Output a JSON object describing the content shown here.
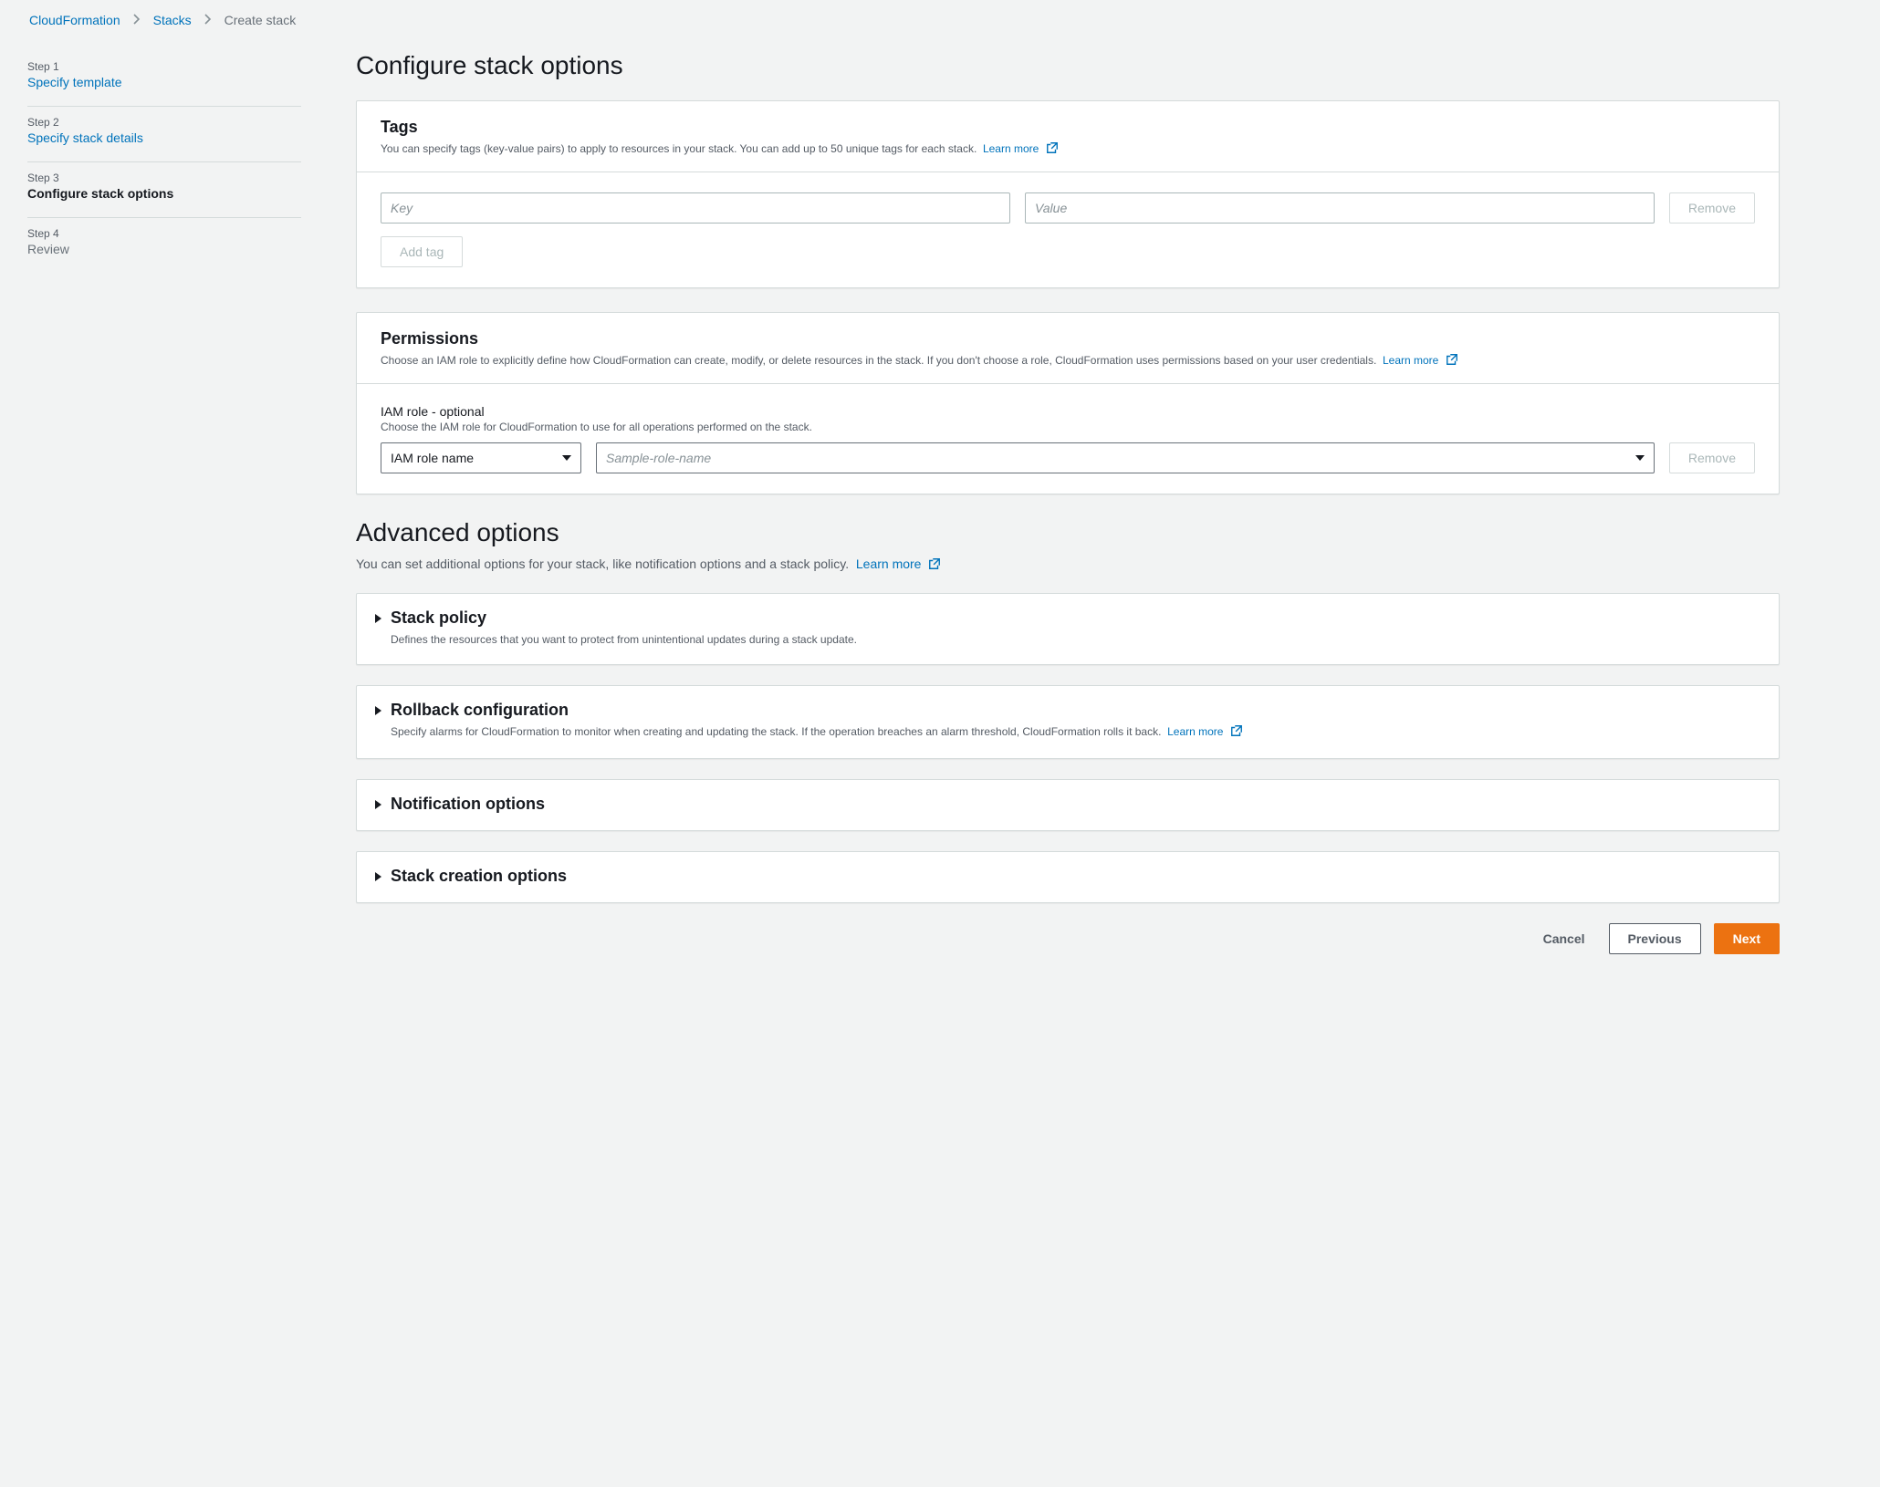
{
  "breadcrumb": {
    "items": [
      {
        "label": "CloudFormation",
        "link": true
      },
      {
        "label": "Stacks",
        "link": true
      },
      {
        "label": "Create stack",
        "link": false
      }
    ]
  },
  "steps": [
    {
      "num": "Step 1",
      "title": "Specify template",
      "state": "link"
    },
    {
      "num": "Step 2",
      "title": "Specify stack details",
      "state": "link"
    },
    {
      "num": "Step 3",
      "title": "Configure stack options",
      "state": "current"
    },
    {
      "num": "Step 4",
      "title": "Review",
      "state": "muted"
    }
  ],
  "page_title": "Configure stack options",
  "tags_panel": {
    "heading": "Tags",
    "description": "You can specify tags (key-value pairs) to apply to resources in your stack. You can add up to 50 unique tags for each stack.",
    "learn_more": "Learn more",
    "key_placeholder": "Key",
    "value_placeholder": "Value",
    "remove_label": "Remove",
    "add_tag_label": "Add tag"
  },
  "permissions_panel": {
    "heading": "Permissions",
    "description": "Choose an IAM role to explicitly define how CloudFormation can create, modify, or delete resources in the stack. If you don't choose a role, CloudFormation uses permissions based on your user credentials.",
    "learn_more": "Learn more",
    "field_label": "IAM role - optional",
    "field_hint": "Choose the IAM role for CloudFormation to use for all operations performed on the stack.",
    "select_type_value": "IAM role name",
    "select_role_placeholder": "Sample-role-name",
    "remove_label": "Remove"
  },
  "advanced": {
    "heading": "Advanced options",
    "description": "You can set additional options for your stack, like notification options and a stack policy.",
    "learn_more": "Learn more",
    "items": [
      {
        "title": "Stack policy",
        "desc": "Defines the resources that you want to protect from unintentional updates during a stack update."
      },
      {
        "title": "Rollback configuration",
        "desc": "Specify alarms for CloudFormation to monitor when creating and updating the stack. If the operation breaches an alarm threshold, CloudFormation rolls it back.",
        "learn_more": "Learn more"
      },
      {
        "title": "Notification options",
        "desc": ""
      },
      {
        "title": "Stack creation options",
        "desc": ""
      }
    ]
  },
  "footer": {
    "cancel": "Cancel",
    "previous": "Previous",
    "next": "Next"
  }
}
